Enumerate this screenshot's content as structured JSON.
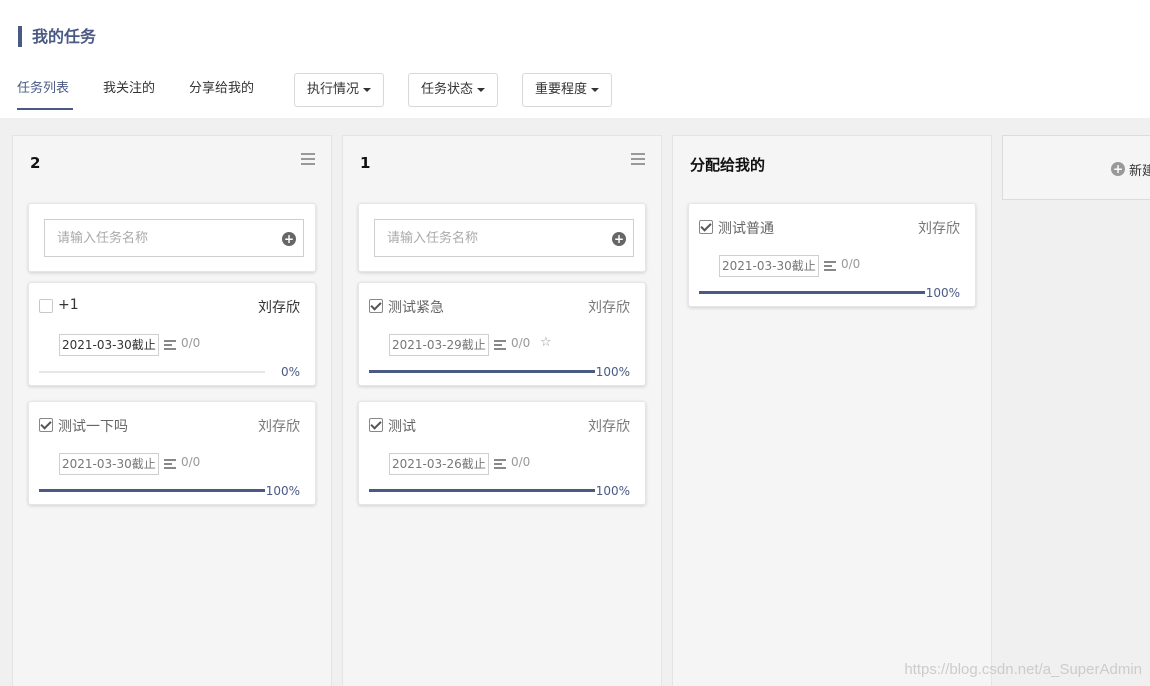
{
  "page": {
    "title": "我的任务"
  },
  "tabs": [
    {
      "label": "任务列表",
      "active": true
    },
    {
      "label": "我关注的",
      "active": false
    },
    {
      "label": "分享给我的",
      "active": false
    }
  ],
  "filters": [
    {
      "label": "执行情况"
    },
    {
      "label": "任务状态"
    },
    {
      "label": "重要程度"
    }
  ],
  "columns": [
    {
      "title": "2",
      "input_placeholder": "请输入任务名称",
      "cards": [
        {
          "name": "+1",
          "checked": false,
          "assignee": "刘存欣",
          "deadline": "2021-03-30截止",
          "subtasks": "0/0",
          "progress": 0,
          "progress_label": "0%"
        },
        {
          "name": "测试一下吗",
          "checked": true,
          "assignee": "刘存欣",
          "deadline": "2021-03-30截止",
          "subtasks": "0/0",
          "progress": 100,
          "progress_label": "100%"
        }
      ]
    },
    {
      "title": "1",
      "input_placeholder": "请输入任务名称",
      "cards": [
        {
          "name": "测试紧急",
          "checked": true,
          "assignee": "刘存欣",
          "deadline": "2021-03-29截止",
          "subtasks": "0/0",
          "starred": true,
          "star_glyph": "☆",
          "progress": 100,
          "progress_label": "100%"
        },
        {
          "name": "测试",
          "checked": true,
          "assignee": "刘存欣",
          "deadline": "2021-03-26截止",
          "subtasks": "0/0",
          "progress": 100,
          "progress_label": "100%"
        }
      ]
    },
    {
      "title": "分配给我的",
      "cards": [
        {
          "name": "测试普通",
          "checked": true,
          "assignee": "刘存欣",
          "deadline": "2021-03-30截止",
          "subtasks": "0/0",
          "progress": 100,
          "progress_label": "100%"
        }
      ]
    }
  ],
  "new_column": {
    "label": "新建"
  },
  "watermark": "https://blog.csdn.net/a_SuperAdmin",
  "colors": {
    "accent": "#4a5a85",
    "board_bg": "#f0f0f0",
    "column_bg": "#f5f5f5"
  }
}
